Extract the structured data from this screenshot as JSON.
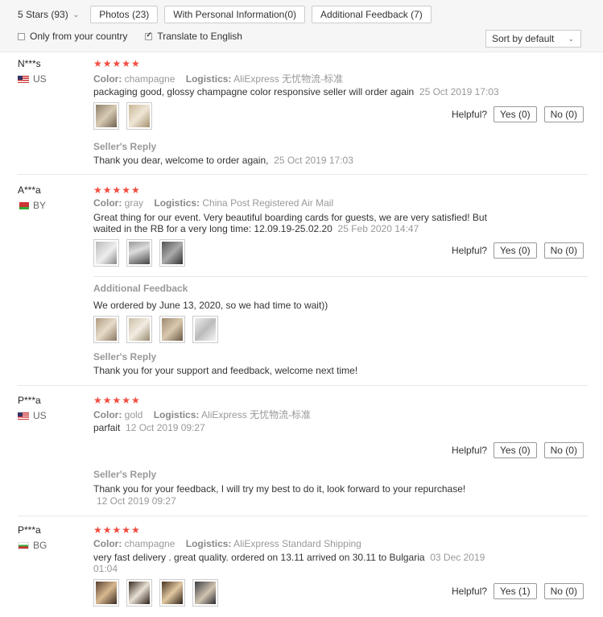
{
  "filters": {
    "star_filter": "5 Stars (93)",
    "photos": "Photos (23)",
    "personal": "With Personal Information(0)",
    "additional": "Additional Feedback (7)",
    "only_country": "Only from your country",
    "translate": "Translate to English",
    "sort": "Sort by default"
  },
  "labels": {
    "color": "Color:",
    "logistics": "Logistics:",
    "helpful": "Helpful?",
    "sellers_reply": "Seller's Reply",
    "additional_feedback": "Additional Feedback",
    "stars": "★★★★★"
  },
  "reviews": [
    {
      "name": "N***s",
      "country": "US",
      "color": "champagne",
      "logistics": "AliExpress 无忧物流-标准",
      "text": "packaging good, glossy champagne color responsive seller will order again",
      "date": "25 Oct 2019 17:03",
      "yes": "Yes (0)",
      "no": "No (0)",
      "reply": "Thank you dear, welcome to order again,",
      "reply_date": "25 Oct 2019 17:03"
    },
    {
      "name": "A***a",
      "country": "BY",
      "color": "gray",
      "logistics": "China Post Registered Air Mail",
      "text_line1": "Great thing for our event. Very beautiful boarding cards for guests, we are very satisfied! But",
      "text_line2": "waited in the RB for a very long time: 12.09.19-25.02.20",
      "date": "25 Feb 2020 14:47",
      "yes": "Yes (0)",
      "no": "No (0)",
      "additional_text": "We ordered by June 13, 2020, so we had time to wait))",
      "reply": "Thank you for your support and feedback, welcome next time!"
    },
    {
      "name": "P***a",
      "country": "US",
      "color": "gold",
      "logistics": "AliExpress 无忧物流-标准",
      "text": "parfait",
      "date": "12 Oct 2019 09:27",
      "yes": "Yes (0)",
      "no": "No (0)",
      "reply": "Thank you for your feedback, I will try my best to do it, look forward to your repurchase!",
      "reply_date": "12 Oct 2019 09:27"
    },
    {
      "name": "P***a",
      "country": "BG",
      "color": "champagne",
      "logistics": "AliExpress Standard Shipping",
      "text": "very fast delivery . great quality. ordered on 13.11 arrived on 30.11 to Bulgaria",
      "date_line1": "03 Dec 2019",
      "date_line2": "01:04",
      "yes": "Yes (1)",
      "no": "No (0)"
    }
  ]
}
